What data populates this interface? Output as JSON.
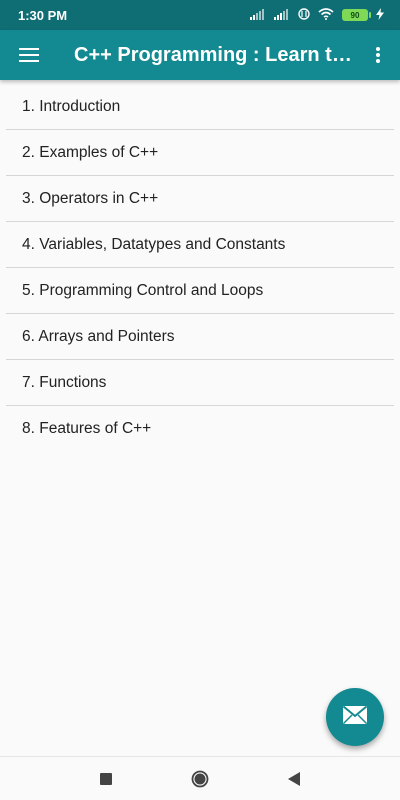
{
  "status_bar": {
    "time": "1:30 PM",
    "battery": "90",
    "icons": [
      "signal-icon",
      "signal-icon",
      "wifi-icon",
      "battery-icon",
      "charging-icon"
    ]
  },
  "app_bar": {
    "title": "C++ Programming : Learn to...",
    "menu_icon": "hamburger-menu-icon",
    "more_icon": "more-vert-icon",
    "color": "#138a91"
  },
  "topics": [
    {
      "label": "1. Introduction"
    },
    {
      "label": "2. Examples of C++"
    },
    {
      "label": "3. Operators in C++"
    },
    {
      "label": "4. Variables, Datatypes and Constants"
    },
    {
      "label": "5. Programming Control and Loops"
    },
    {
      "label": "6. Arrays and Pointers"
    },
    {
      "label": "7. Functions"
    },
    {
      "label": "8. Features of C++"
    }
  ],
  "fab": {
    "icon": "email-icon"
  },
  "nav_bar": {
    "icons": [
      "recents-square-icon",
      "home-circle-icon",
      "back-triangle-icon"
    ]
  }
}
